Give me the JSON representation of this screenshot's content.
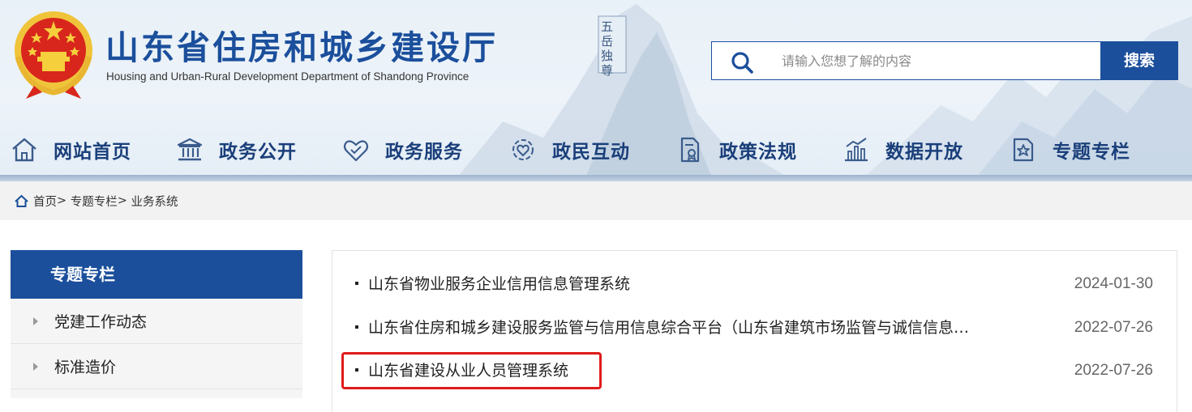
{
  "header": {
    "title": "山东省住房和城乡建设厅",
    "subtitle": "Housing and Urban-Rural Development Department of Shandong Province",
    "seal_text": "五岳独尊"
  },
  "search": {
    "placeholder": "请输入您想了解的内容",
    "button_label": "搜索"
  },
  "nav": {
    "items": [
      {
        "label": "网站首页",
        "icon": "home-icon"
      },
      {
        "label": "政务公开",
        "icon": "government-building-icon"
      },
      {
        "label": "政务服务",
        "icon": "handshake-heart-icon"
      },
      {
        "label": "政民互动",
        "icon": "people-interaction-icon"
      },
      {
        "label": "政策法规",
        "icon": "policy-document-icon"
      },
      {
        "label": "数据开放",
        "icon": "bar-chart-icon"
      },
      {
        "label": "专题专栏",
        "icon": "star-document-icon"
      }
    ]
  },
  "breadcrumb": {
    "home": "首页",
    "separator": ">",
    "level1": "专题专栏",
    "level2": "业务系统"
  },
  "sidebar": {
    "heading": "专题专栏",
    "items": [
      {
        "label": "党建工作动态"
      },
      {
        "label": "标准造价"
      }
    ]
  },
  "list": {
    "rows": [
      {
        "title": "山东省物业服务企业信用信息管理系统",
        "date": "2024-01-30"
      },
      {
        "title": "山东省住房和城乡建设服务监管与信用信息综合平台（山东省建筑市场监管与诚信信息…",
        "date": "2022-07-26"
      },
      {
        "title": "山东省建设从业人员管理系统",
        "date": "2022-07-26",
        "highlighted": true
      }
    ]
  },
  "colors": {
    "brand_blue": "#1b4f9c",
    "nav_text": "#1a3f7a",
    "highlight_red": "#e01b1b"
  }
}
